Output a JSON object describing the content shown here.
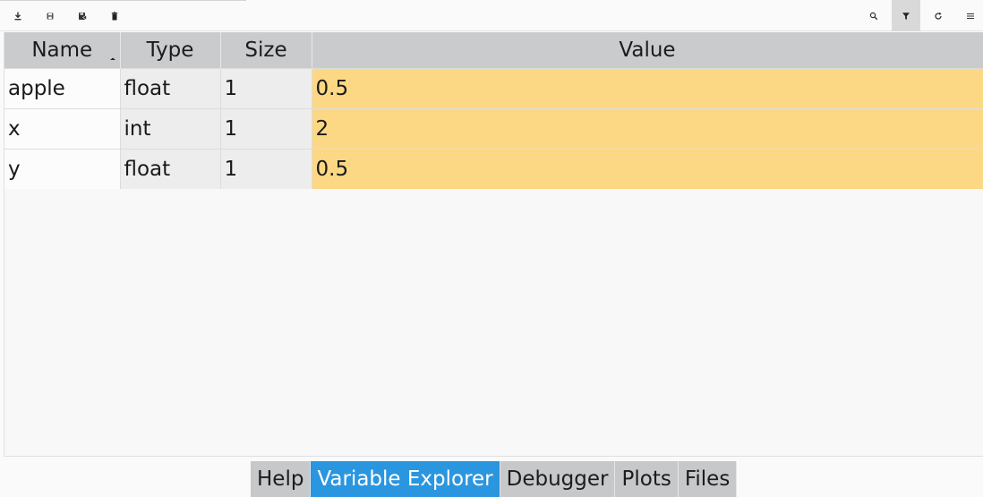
{
  "toolbar": {
    "left_buttons": [
      "import-data-icon",
      "save-icon",
      "save-as-icon",
      "delete-icon"
    ],
    "right_buttons": [
      "search-icon",
      "filter-icon",
      "refresh-icon",
      "menu-icon"
    ],
    "active_button": "filter-icon"
  },
  "table": {
    "columns": [
      "Name",
      "Type",
      "Size",
      "Value"
    ],
    "sort_column": "Name",
    "sort_direction": "ascending",
    "rows": [
      {
        "name": "apple",
        "type": "float",
        "size": "1",
        "value": "0.5"
      },
      {
        "name": "x",
        "type": "int",
        "size": "1",
        "value": "2"
      },
      {
        "name": "y",
        "type": "float",
        "size": "1",
        "value": "0.5"
      }
    ]
  },
  "tabs": {
    "items": [
      "Help",
      "Variable Explorer",
      "Debugger",
      "Plots",
      "Files"
    ],
    "active": "Variable Explorer"
  },
  "colors": {
    "header_bg": "#c9cbcd",
    "value_highlight": "#fdd884",
    "active_tab": "#2a96e0"
  }
}
